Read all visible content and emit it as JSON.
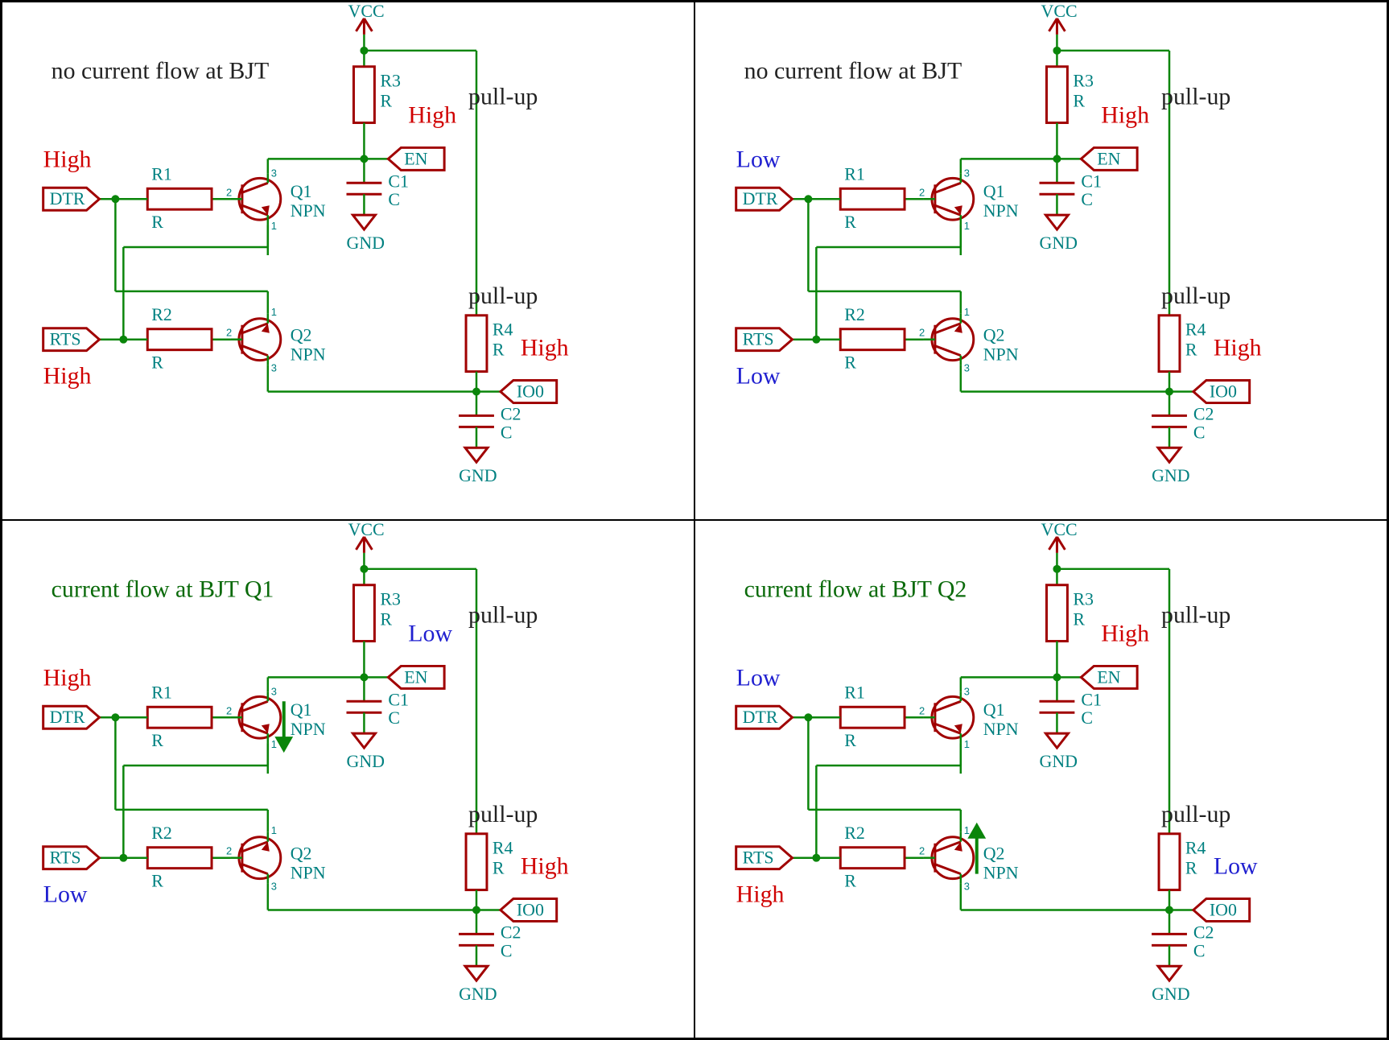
{
  "common": {
    "vcc": "VCC",
    "gnd": "GND",
    "en": "EN",
    "io0": "IO0",
    "dtr": "DTR",
    "rts": "RTS",
    "r1_name": "R1",
    "r1_val": "R",
    "r2_name": "R2",
    "r2_val": "R",
    "r3_name": "R3",
    "r3_val": "R",
    "r4_name": "R4",
    "r4_val": "R",
    "c1_name": "C1",
    "c1_val": "C",
    "c2_name": "C2",
    "c2_val": "C",
    "q1_name": "Q1",
    "q1_val": "NPN",
    "q2_name": "Q2",
    "q2_val": "NPN",
    "pullup": "pull-up",
    "pin1": "1",
    "pin2": "2",
    "pin3": "3"
  },
  "panels": [
    {
      "id": "tl",
      "title": "no current flow at BJT",
      "title_color": "t-blk",
      "dtr_state": "High",
      "dtr_color": "t-red",
      "rts_state": "High",
      "rts_color": "t-red",
      "en_state": "High",
      "en_color": "t-red",
      "io0_state": "High",
      "io0_color": "t-red",
      "arrow_q1": false,
      "arrow_q2": false
    },
    {
      "id": "tr",
      "title": "no current flow at BJT",
      "title_color": "t-blk",
      "dtr_state": "Low",
      "dtr_color": "t-blue",
      "rts_state": "Low",
      "rts_color": "t-blue",
      "en_state": "High",
      "en_color": "t-red",
      "io0_state": "High",
      "io0_color": "t-red",
      "arrow_q1": false,
      "arrow_q2": false
    },
    {
      "id": "bl",
      "title": "current flow at BJT Q1",
      "title_color": "t-grn",
      "dtr_state": "High",
      "dtr_color": "t-red",
      "rts_state": "Low",
      "rts_color": "t-blue",
      "en_state": "Low",
      "en_color": "t-blue",
      "io0_state": "High",
      "io0_color": "t-red",
      "arrow_q1": true,
      "arrow_q2": false
    },
    {
      "id": "br",
      "title": "current flow at BJT Q2",
      "title_color": "t-grn",
      "dtr_state": "Low",
      "dtr_color": "t-blue",
      "rts_state": "High",
      "rts_color": "t-red",
      "en_state": "High",
      "en_color": "t-red",
      "io0_state": "Low",
      "io0_color": "t-blue",
      "arrow_q1": false,
      "arrow_q2": true
    }
  ]
}
